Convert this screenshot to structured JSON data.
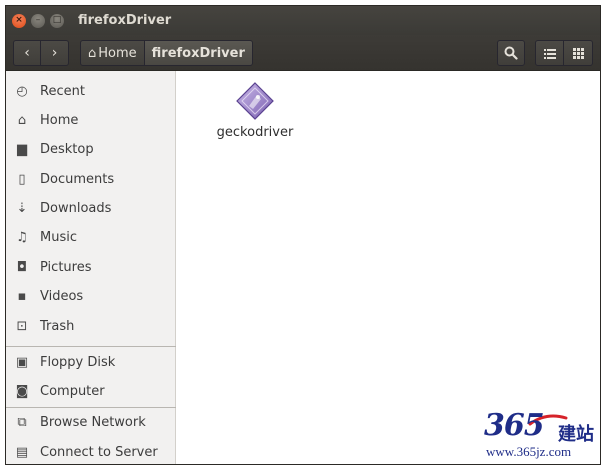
{
  "window": {
    "title": "firefoxDriver",
    "close_glyph": "×",
    "minimize_glyph": "–",
    "maximize_glyph": "□"
  },
  "toolbar": {
    "back_glyph": "‹",
    "forward_glyph": "›",
    "breadcrumb": [
      {
        "label": "Home",
        "icon": "home-icon"
      },
      {
        "label": "firefoxDriver"
      }
    ],
    "search_icon": "search-icon",
    "list_view_icon": "list-view-icon",
    "grid_view_icon": "grid-view-icon"
  },
  "sidebar": {
    "places": [
      {
        "label": "Recent",
        "icon": "clock-icon",
        "glyph": "◴"
      },
      {
        "label": "Home",
        "icon": "home-icon",
        "glyph": "⌂"
      },
      {
        "label": "Desktop",
        "icon": "folder-icon",
        "glyph": "▆"
      },
      {
        "label": "Documents",
        "icon": "document-icon",
        "glyph": "▯"
      },
      {
        "label": "Downloads",
        "icon": "download-icon",
        "glyph": "⇣"
      },
      {
        "label": "Music",
        "icon": "music-icon",
        "glyph": "♫"
      },
      {
        "label": "Pictures",
        "icon": "camera-icon",
        "glyph": "◘"
      },
      {
        "label": "Videos",
        "icon": "video-icon",
        "glyph": "▪"
      },
      {
        "label": "Trash",
        "icon": "trash-icon",
        "glyph": "⊡"
      }
    ],
    "devices": [
      {
        "label": "Floppy Disk",
        "icon": "floppy-icon",
        "glyph": "▣"
      },
      {
        "label": "Computer",
        "icon": "computer-icon",
        "glyph": "◙"
      }
    ],
    "network": [
      {
        "label": "Browse Network",
        "icon": "network-icon",
        "glyph": "⧉"
      },
      {
        "label": "Connect to Server",
        "icon": "server-icon",
        "glyph": "▤"
      }
    ]
  },
  "content": {
    "files": [
      {
        "name": "geckodriver",
        "icon": "executable-icon"
      }
    ]
  },
  "watermark": {
    "number": "365",
    "chinese": "建站",
    "url": "www.365jz.com"
  },
  "colors": {
    "titlebar": "#3b3a36",
    "accent_close": "#df4a16",
    "sidebar_bg": "#f2f1f0",
    "watermark": "#1f2d88"
  }
}
